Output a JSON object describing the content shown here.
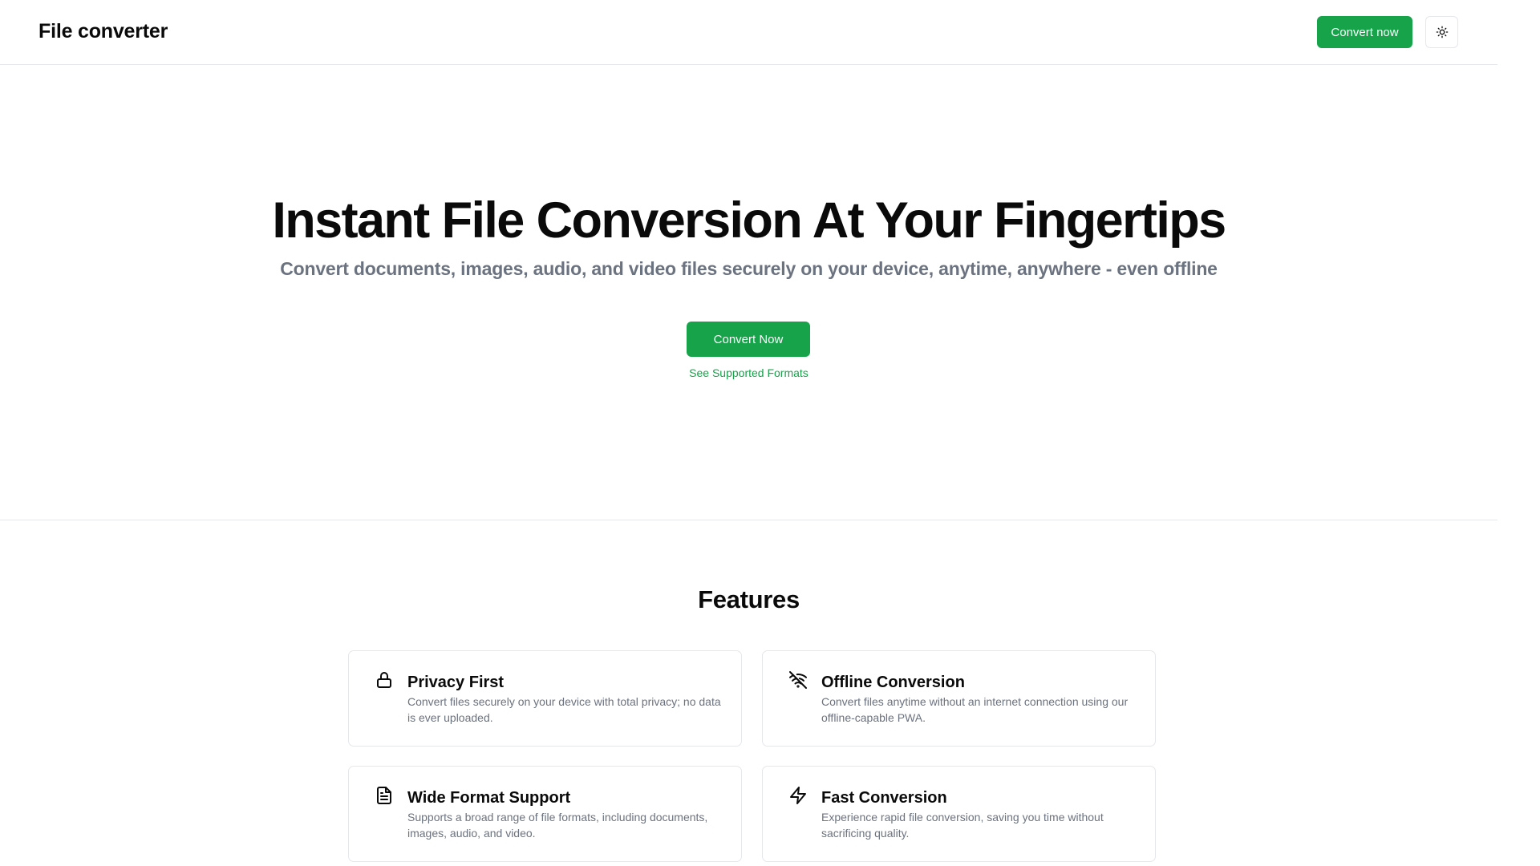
{
  "header": {
    "brand": "File converter",
    "convert_button": "Convert now",
    "theme_toggle_icon": "sun-icon"
  },
  "hero": {
    "title": "Instant File Conversion At Your Fingertips",
    "subtitle": "Convert documents, images, audio, and video files securely on your device, anytime, anywhere - even offline",
    "cta_button": "Convert Now",
    "secondary_link": "See Supported Formats"
  },
  "features": {
    "heading": "Features",
    "items": [
      {
        "icon": "lock-icon",
        "title": "Privacy First",
        "description": "Convert files securely on your device with total privacy; no data is ever uploaded."
      },
      {
        "icon": "wifi-off-icon",
        "title": "Offline Conversion",
        "description": "Convert files anytime without an internet connection using our offline-capable PWA."
      },
      {
        "icon": "file-text-icon",
        "title": "Wide Format Support",
        "description": "Supports a broad range of file formats, including documents, images, audio, and video."
      },
      {
        "icon": "zap-icon",
        "title": "Fast Conversion",
        "description": "Experience rapid file conversion, saving you time without sacrificing quality."
      }
    ]
  },
  "colors": {
    "accent": "#16a34a",
    "muted_text": "#6b7280",
    "border": "#e5e7eb"
  }
}
